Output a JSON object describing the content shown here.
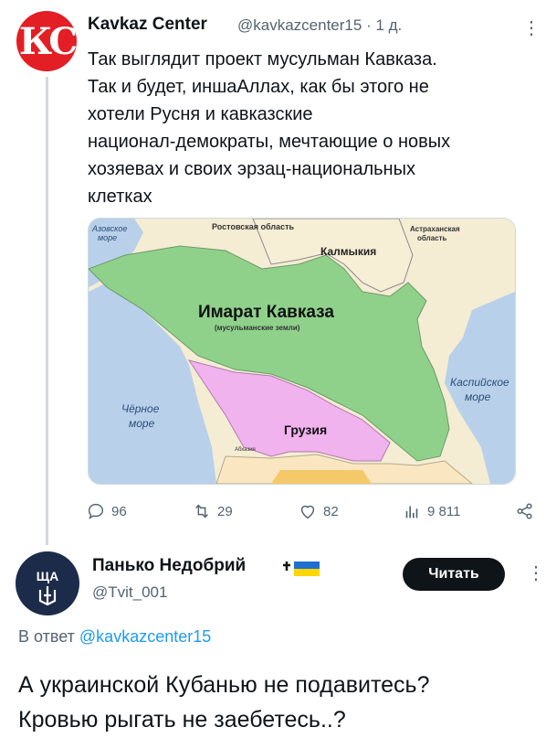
{
  "tweet": {
    "author_name": "Kavkaz Center",
    "author_handle": "@kavkazcenter15",
    "time": "· 1 д.",
    "more": "⋮",
    "avatar_text": "КС",
    "text": "Так выглядит проект мусульман Кавказа.\nТак и будет, иншаАллах, как бы этого не\nхотели Русня и кавказские\nнационал-демократы, мечтающие о новых\nхозяевах и своих эрзац-национальных\nклетках",
    "map": {
      "labels": {
        "azov": "Азовское",
        "azov2": "море",
        "rostov": "Ростовская область",
        "astrakhan": "Астраханская",
        "astrakhan2": "область",
        "kalmykia": "Калмыкия",
        "imarat": "Имарат Кавказа",
        "imarat_sub": "(мусульманские земли)",
        "black_sea": "Чёрное",
        "black_sea2": "море",
        "caspian": "Каспийское",
        "caspian2": "море",
        "georgia": "Грузия",
        "abkhazia": "Абхазия"
      },
      "colors": {
        "imarat": "#8fd18b",
        "georgia": "#f0b3ee",
        "sea": "#b8d0ea",
        "land": "#f4ecd3",
        "land2": "#fae7c2"
      }
    },
    "stats": {
      "replies": "96",
      "retweets": "29",
      "likes": "82",
      "views": "9 811"
    }
  },
  "reply": {
    "author_name": "Панько Недобрий",
    "author_handle": "@Tvit_001",
    "follow_label": "Читать",
    "more": "⋮",
    "reply_prefix": "В ответ",
    "reply_handle": "@kavkazcenter15",
    "text": "А украинской Кубанью не подавитесь?\nКровью рыгать не заебетесь..?"
  }
}
